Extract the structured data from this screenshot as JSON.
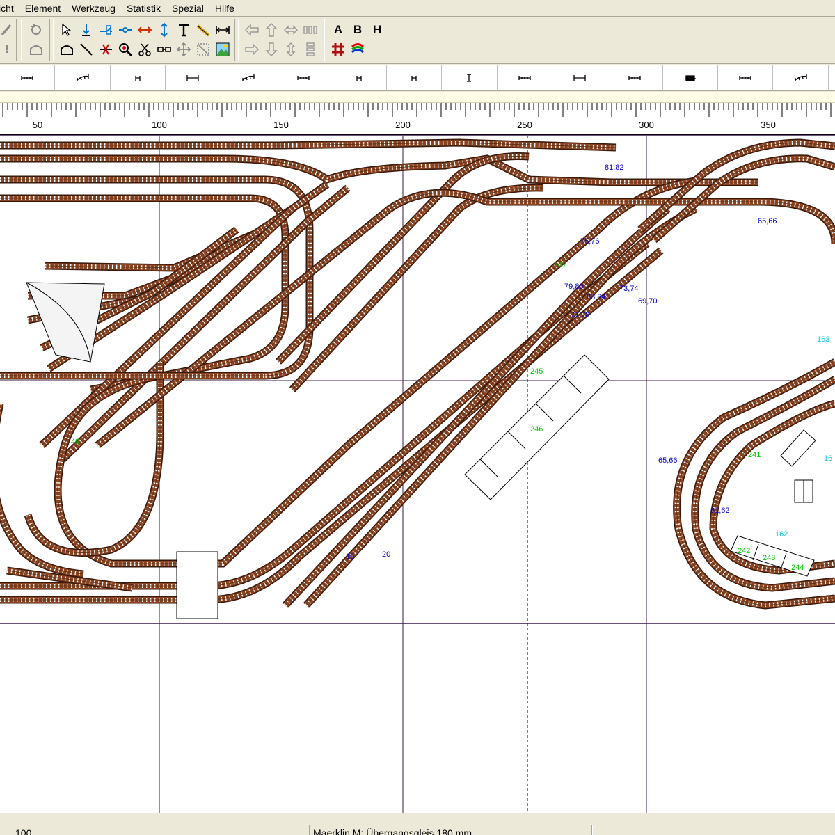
{
  "menu": [
    "icht",
    "Element",
    "Werkzeug",
    "Statistik",
    "Spezial",
    "Hilfe"
  ],
  "toolbar": {
    "groups": [
      {
        "name": "edit-tools",
        "buttons": [
          "pencil-icon",
          "exclamation-icon"
        ]
      },
      {
        "name": "view-tools",
        "buttons": [
          "rotate-icon",
          "arch-icon"
        ]
      },
      {
        "name": "element-tools",
        "buttons": [
          "select-arrow-icon",
          "track-end-icon",
          "switch-icon",
          "link-icon",
          "double-arrow-icon",
          "vertical-measure-icon",
          "text-icon",
          "diagonal-track-icon",
          "horizontal-measure-icon",
          "tunnel-icon",
          "line-icon",
          "cut-icon",
          "zoom-icon",
          "scissors-icon",
          "connector-icon",
          "move-icon",
          "scale-icon",
          "terrain-icon"
        ]
      },
      {
        "name": "move-tools",
        "buttons": [
          "move-left-icon",
          "move-up-icon",
          "move-horizontal-icon",
          "align-icon",
          "move-right-icon",
          "move-down-icon",
          "move-vertical-icon",
          "align-vertical-icon"
        ]
      },
      {
        "name": "layer-tools",
        "buttons": [
          "A",
          "B",
          "H",
          "grid-icon",
          "color-layers-icon"
        ]
      }
    ],
    "letters": {
      "a": "A",
      "b": "B",
      "h": "H"
    }
  },
  "palette": [
    "straight-track-icon",
    "curve-track-icon",
    "short-track-icon",
    "buffer-track-icon",
    "curve-track-icon",
    "straight-track-icon",
    "short-track-icon",
    "short-track-icon",
    "tall-track-icon",
    "straight-track-icon",
    "buffer-track-icon",
    "straight-track-icon",
    "bridge-track-icon",
    "straight-track-icon",
    "curve-track-icon"
  ],
  "ruler": {
    "labels": [
      "50",
      "100",
      "150",
      "200",
      "250",
      "300",
      "350"
    ]
  },
  "canvas": {
    "colors": {
      "track": "#7a3b1c",
      "tie": "#ffffff",
      "grid": "#3a1850",
      "label_red": "#e00000",
      "label_blue": "#0000cc",
      "label_green": "#00cc00",
      "label_cyan": "#00c8e0"
    },
    "labels": [
      {
        "text": "81,82",
        "color": "blue"
      },
      {
        "text": "65,66",
        "color": "blue"
      },
      {
        "text": "75,76",
        "color": "blue"
      },
      {
        "text": "247",
        "color": "green"
      },
      {
        "text": "79,80",
        "color": "blue"
      },
      {
        "text": "83,84",
        "color": "blue"
      },
      {
        "text": "73,74",
        "color": "blue"
      },
      {
        "text": "69,70",
        "color": "blue"
      },
      {
        "text": "77,78",
        "color": "blue"
      },
      {
        "text": "163",
        "color": "cyan"
      },
      {
        "text": "245",
        "color": "green"
      },
      {
        "text": "246",
        "color": "green"
      },
      {
        "text": "65,66",
        "color": "blue"
      },
      {
        "text": "241",
        "color": "green"
      },
      {
        "text": "16",
        "color": "cyan"
      },
      {
        "text": "61,62",
        "color": "blue"
      },
      {
        "text": "162",
        "color": "cyan"
      },
      {
        "text": "242",
        "color": "green"
      },
      {
        "text": "243",
        "color": "green"
      },
      {
        "text": "244",
        "color": "green"
      },
      {
        "text": "40",
        "color": "green"
      },
      {
        "text": "20",
        "color": "blue"
      },
      {
        "text": "19",
        "color": "blue"
      }
    ]
  },
  "status": {
    "zoom": "100",
    "element": "Maerklin M: Übergangsgleis 180 mm"
  }
}
